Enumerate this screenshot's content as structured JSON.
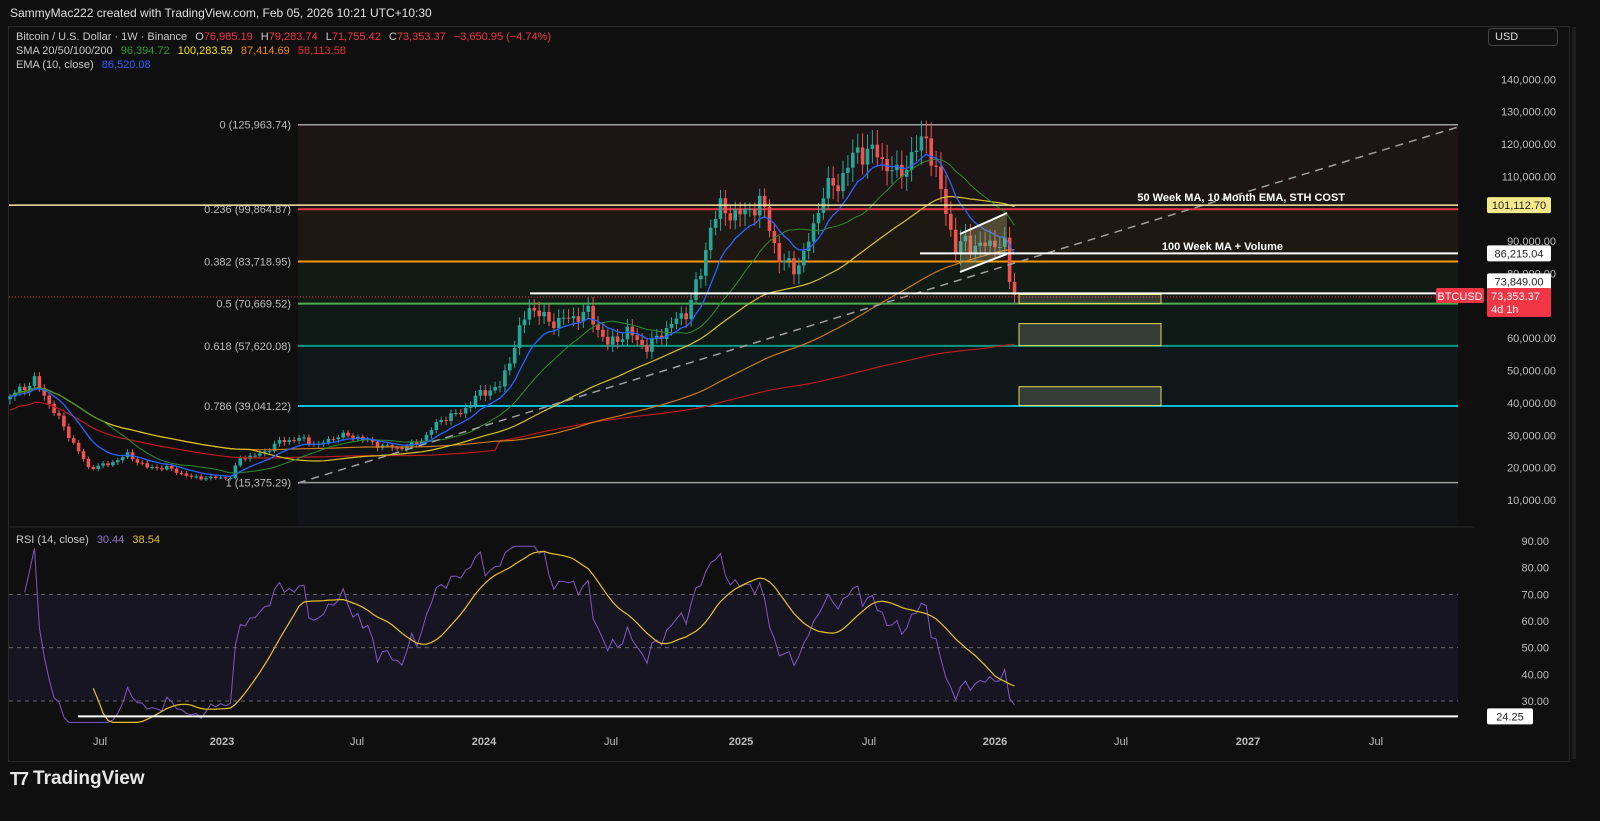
{
  "header": {
    "credit": "SammyMac222 created with TradingView.com, Feb 05, 2026 10:21 UTC+10:30"
  },
  "legend": {
    "symbol": "Bitcoin / U.S. Dollar · 1W · Binance",
    "o_label": "O",
    "open": "76,985.19",
    "h_label": "H",
    "high": "79,283.74",
    "l_label": "L",
    "low": "71,755.42",
    "c_label": "C",
    "close": "73,353.37",
    "change": "−3,650.95 (−4.74%)",
    "sma_label": "SMA 20/50/100/200",
    "sma20": "96,394.72",
    "sma50": "100,283.59",
    "sma100": "87,414.69",
    "sma200": "58,113.58",
    "ema_label": "EMA (10, close)",
    "ema10": "86,520.08",
    "rsi_label": "RSI (14, close)",
    "rsi": "30.44",
    "rsi_ma": "38.54"
  },
  "currency_button": "USD",
  "logo": "TradingView",
  "colors": {
    "up": "#26a69a",
    "down": "#ef5350",
    "sma20": "#2e8b2e",
    "sma50": "#d4c22a",
    "sma100": "#c77a1a",
    "sma200": "#b71c1c",
    "ema10": "#2962ff",
    "rsi": "#7e57c2",
    "rsi_ma": "#e6c229"
  },
  "chart_data": {
    "type": "candlestick",
    "price_axis": {
      "ticks": [
        "140,000.00",
        "130,000.00",
        "120,000.00",
        "110,000.00",
        "90,000.00",
        "80,000.00",
        "60,000.00",
        "50,000.00",
        "40,000.00",
        "30,000.00",
        "20,000.00",
        "10,000.00"
      ],
      "values": [
        140000,
        130000,
        120000,
        110000,
        90000,
        80000,
        60000,
        50000,
        40000,
        30000,
        20000,
        10000
      ]
    },
    "time_axis": [
      "Jul",
      "2023",
      "Jul",
      "2024",
      "Jul",
      "2025",
      "Jul",
      "2026",
      "Jul",
      "2027",
      "Jul"
    ],
    "price_keypoints_week_price": [
      [
        0,
        42000
      ],
      [
        5,
        47000
      ],
      [
        8,
        40000
      ],
      [
        12,
        30000
      ],
      [
        16,
        20000
      ],
      [
        20,
        21000
      ],
      [
        24,
        24000
      ],
      [
        28,
        20000
      ],
      [
        32,
        20000
      ],
      [
        37,
        17000
      ],
      [
        41,
        16800
      ],
      [
        45,
        17000
      ],
      [
        47,
        23000
      ],
      [
        51,
        24000
      ],
      [
        55,
        28000
      ],
      [
        59,
        29000
      ],
      [
        63,
        27000
      ],
      [
        67,
        30000
      ],
      [
        71,
        29500
      ],
      [
        75,
        27000
      ],
      [
        79,
        26000
      ],
      [
        83,
        27500
      ],
      [
        85,
        30000
      ],
      [
        88,
        35000
      ],
      [
        92,
        37000
      ],
      [
        96,
        43000
      ],
      [
        100,
        45000
      ],
      [
        104,
        62000
      ],
      [
        106,
        70000
      ],
      [
        110,
        65000
      ],
      [
        114,
        66000
      ],
      [
        118,
        68000
      ],
      [
        122,
        58000
      ],
      [
        126,
        62000
      ],
      [
        130,
        57000
      ],
      [
        134,
        63000
      ],
      [
        138,
        68000
      ],
      [
        141,
        80000
      ],
      [
        143,
        95000
      ],
      [
        145,
        100000
      ],
      [
        149,
        98000
      ],
      [
        153,
        102000
      ],
      [
        155,
        95000
      ],
      [
        157,
        84000
      ],
      [
        160,
        82000
      ],
      [
        162,
        85000
      ],
      [
        164,
        95000
      ],
      [
        166,
        105000
      ],
      [
        169,
        108000
      ],
      [
        173,
        118000
      ],
      [
        177,
        117000
      ],
      [
        181,
        110000
      ],
      [
        185,
        118000
      ],
      [
        187,
        123000
      ],
      [
        189,
        110000
      ],
      [
        191,
        100000
      ],
      [
        193,
        87000
      ],
      [
        195,
        90000
      ],
      [
        198,
        88000
      ],
      [
        201,
        90000
      ],
      [
        203,
        88000
      ],
      [
        204,
        78000
      ],
      [
        205,
        73353
      ]
    ],
    "fib": {
      "levels": [
        {
          "ratio": "0",
          "price": 125963.74,
          "label": "0 (125,963.74)",
          "color": "#9e9e9e"
        },
        {
          "ratio": "0.236",
          "price": 99864.87,
          "label": "0.236 (99,864.87)",
          "color": "#f23645"
        },
        {
          "ratio": "0.382",
          "price": 83718.95,
          "label": "0.382 (83,718.95)",
          "color": "#ff9800"
        },
        {
          "ratio": "0.5",
          "price": 70669.52,
          "label": "0.5 (70,669.52)",
          "color": "#4caf50"
        },
        {
          "ratio": "0.618",
          "price": 57620.08,
          "label": "0.618 (57,620.08)",
          "color": "#089981"
        },
        {
          "ratio": "0.786",
          "price": 39041.22,
          "label": "0.786 (39,041.22)",
          "color": "#00bcd4"
        },
        {
          "ratio": "1",
          "price": 15375.29,
          "label": "1 (15,375.29)",
          "color": "#9e9e9e"
        }
      ]
    },
    "annotations": {
      "ma_line": {
        "price": 101112.7,
        "label": "50 Week MA, 10 Month EMA, STH COST",
        "tag": "101,112.70"
      },
      "volume_line": {
        "price": 86215.04,
        "label": "100 Week MA + Volume",
        "tag": "86,215.04"
      },
      "support_line": {
        "price": 73849.0,
        "tag": "73,849.00"
      },
      "last_price": {
        "symbol": "BTCUSD",
        "price": 73353.37,
        "tag": "73,353.37",
        "countdown": "4d 1h"
      },
      "zones": [
        [
          70700,
          73500
        ],
        [
          57700,
          64500
        ],
        [
          39200,
          45000
        ]
      ]
    },
    "rsi_axis": {
      "ticks": [
        "90.00",
        "80.00",
        "70.00",
        "60.00",
        "50.00",
        "40.00",
        "30.00"
      ],
      "values": [
        90,
        80,
        70,
        60,
        50,
        40,
        30
      ],
      "support": 24.25,
      "support_tag": "24.25"
    }
  }
}
